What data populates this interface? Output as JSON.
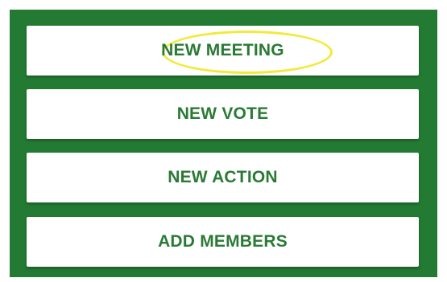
{
  "colors": {
    "panel_background": "#237a32",
    "button_background": "#ffffff",
    "button_text": "#2a7a35",
    "highlight_ring": "#f2ea3b"
  },
  "menu": {
    "buttons": [
      {
        "label": "NEW MEETING",
        "highlighted": true
      },
      {
        "label": "NEW VOTE",
        "highlighted": false
      },
      {
        "label": "NEW ACTION",
        "highlighted": false
      },
      {
        "label": "ADD MEMBERS",
        "highlighted": false
      }
    ]
  }
}
